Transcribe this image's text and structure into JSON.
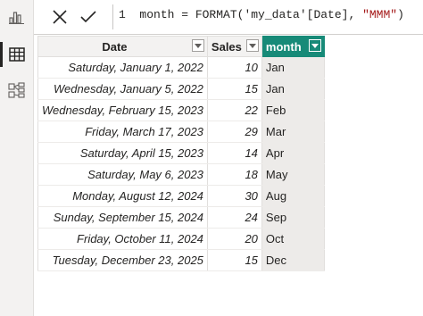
{
  "formula": {
    "line_number": "1",
    "prefix": "month = FORMAT('my_data'[Date], ",
    "format_string": "\"MMM\"",
    "suffix": ")",
    "cancel_icon": "close-icon",
    "commit_icon": "check-icon"
  },
  "rail": {
    "items": [
      {
        "icon": "report-view-icon"
      },
      {
        "icon": "table-view-icon"
      },
      {
        "icon": "model-view-icon"
      }
    ]
  },
  "table": {
    "columns": [
      "Date",
      "Sales",
      "month"
    ],
    "rows": [
      {
        "date": "Saturday, January 1, 2022",
        "sales": "10",
        "month": "Jan"
      },
      {
        "date": "Wednesday, January 5, 2022",
        "sales": "15",
        "month": "Jan"
      },
      {
        "date": "Wednesday, February 15, 2023",
        "sales": "22",
        "month": "Feb"
      },
      {
        "date": "Friday, March 17, 2023",
        "sales": "29",
        "month": "Mar"
      },
      {
        "date": "Saturday, April 15, 2023",
        "sales": "14",
        "month": "Apr"
      },
      {
        "date": "Saturday, May 6, 2023",
        "sales": "18",
        "month": "May"
      },
      {
        "date": "Monday, August 12, 2024",
        "sales": "30",
        "month": "Aug"
      },
      {
        "date": "Sunday, September 15, 2024",
        "sales": "24",
        "month": "Sep"
      },
      {
        "date": "Friday, October 11, 2024",
        "sales": "20",
        "month": "Oct"
      },
      {
        "date": "Tuesday, December 23, 2025",
        "sales": "15",
        "month": "Dec"
      }
    ]
  },
  "colors": {
    "selected_column_header": "#178a78",
    "header_background": "#f3f2f1",
    "formula_string": "#a31515"
  }
}
